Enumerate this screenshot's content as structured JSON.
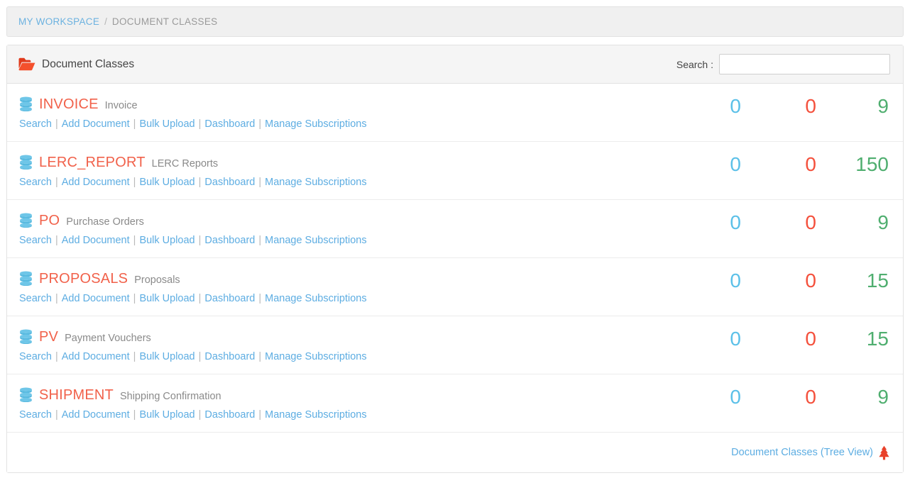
{
  "breadcrumb": {
    "root": "MY WORKSPACE",
    "separator": "/",
    "current": "DOCUMENT CLASSES"
  },
  "panel": {
    "title": "Document Classes",
    "title_icon": "open-folder-icon",
    "search": {
      "label": "Search :",
      "value": "",
      "placeholder": ""
    },
    "footer": {
      "tree_view_label": "Document Classes (Tree View)",
      "tree_view_icon": "tree-icon"
    }
  },
  "actions": {
    "search": "Search",
    "add_document": "Add Document",
    "bulk_upload": "Bulk Upload",
    "dashboard": "Dashboard",
    "manage_subscriptions": "Manage Subscriptions",
    "separator": "|"
  },
  "colors": {
    "class_code": "#f1614a",
    "link": "#5dade2",
    "count_blue": "#5bc0e8",
    "count_red": "#f4503c",
    "count_green": "#4fae6f",
    "folder_icon": "#ef4423",
    "db_icon": "#6ec6e8",
    "tree_icon": "#e8412a"
  },
  "rows": [
    {
      "code": "INVOICE",
      "description": "Invoice",
      "icon": "database-icon",
      "count_blue": "0",
      "count_red": "0",
      "count_green": "9"
    },
    {
      "code": "LERC_REPORT",
      "description": "LERC Reports",
      "icon": "database-icon",
      "count_blue": "0",
      "count_red": "0",
      "count_green": "150"
    },
    {
      "code": "PO",
      "description": "Purchase Orders",
      "icon": "database-icon",
      "count_blue": "0",
      "count_red": "0",
      "count_green": "9"
    },
    {
      "code": "PROPOSALS",
      "description": "Proposals",
      "icon": "database-icon",
      "count_blue": "0",
      "count_red": "0",
      "count_green": "15"
    },
    {
      "code": "PV",
      "description": "Payment Vouchers",
      "icon": "database-icon",
      "count_blue": "0",
      "count_red": "0",
      "count_green": "15"
    },
    {
      "code": "SHIPMENT",
      "description": "Shipping Confirmation",
      "icon": "database-icon",
      "count_blue": "0",
      "count_red": "0",
      "count_green": "9"
    }
  ]
}
